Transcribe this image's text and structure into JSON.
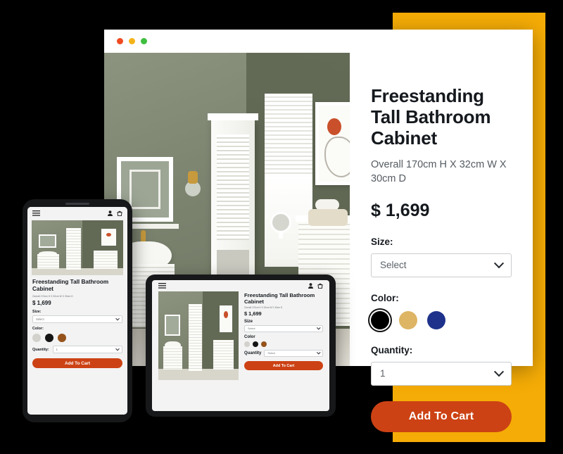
{
  "background_color": "#000000",
  "accent_yellow": "#F5AC06",
  "accent_orange": "#CC4214",
  "browser": {
    "traffic_lights": [
      "red",
      "amber",
      "green"
    ],
    "photo_alt": "sage-green bathroom with white freestanding tall cabinet"
  },
  "desktop": {
    "title": "Freestanding Tall Bathroom Cabinet",
    "subtitle": "Overall 170cm H X 32cm W X 30cm D",
    "price": "$ 1,699",
    "size_label": "Size:",
    "size_value": "Select",
    "color_label": "Color:",
    "colors": [
      {
        "name": "black",
        "hex": "#000000",
        "selected": true
      },
      {
        "name": "gold",
        "hex": "#DDB565",
        "selected": false
      },
      {
        "name": "navy",
        "hex": "#1E328C",
        "selected": false
      }
    ],
    "quantity_label": "Quantity:",
    "quantity_value": "1",
    "cta": "Add To Cart"
  },
  "mobile": {
    "title": "Freestanding Tall Bathroom Cabinet",
    "subtitle": "Overall 170cm H X 32cm W X 30cm D",
    "price": "$ 1,699",
    "size_label": "Size:",
    "size_value": "Select",
    "color_label": "Color:",
    "colors": [
      {
        "name": "light-gray",
        "hex": "#D2D1CC"
      },
      {
        "name": "black",
        "hex": "#141414"
      },
      {
        "name": "brown",
        "hex": "#95531B"
      }
    ],
    "quantity_label": "Quantity:",
    "quantity_value": "1",
    "cta": "Add To Cart",
    "nav_icons": [
      "menu-icon",
      "user-icon",
      "cart-icon"
    ]
  },
  "tablet": {
    "title": "Freestanding Tall Bathroom Cabinet",
    "subtitle": "Overall 170cm H X 32cm W X 30cm D",
    "price": "$ 1,699",
    "size_label": "Size",
    "size_value": "Select",
    "color_label": "Color",
    "colors": [
      {
        "name": "light-gray",
        "hex": "#D2D1CC"
      },
      {
        "name": "black",
        "hex": "#141414"
      },
      {
        "name": "brown",
        "hex": "#95531B"
      }
    ],
    "quantity_label": "Quantity",
    "quantity_value": "Select",
    "cta": "Add To Cart",
    "nav_icons": [
      "menu-icon",
      "user-icon",
      "cart-icon"
    ]
  }
}
